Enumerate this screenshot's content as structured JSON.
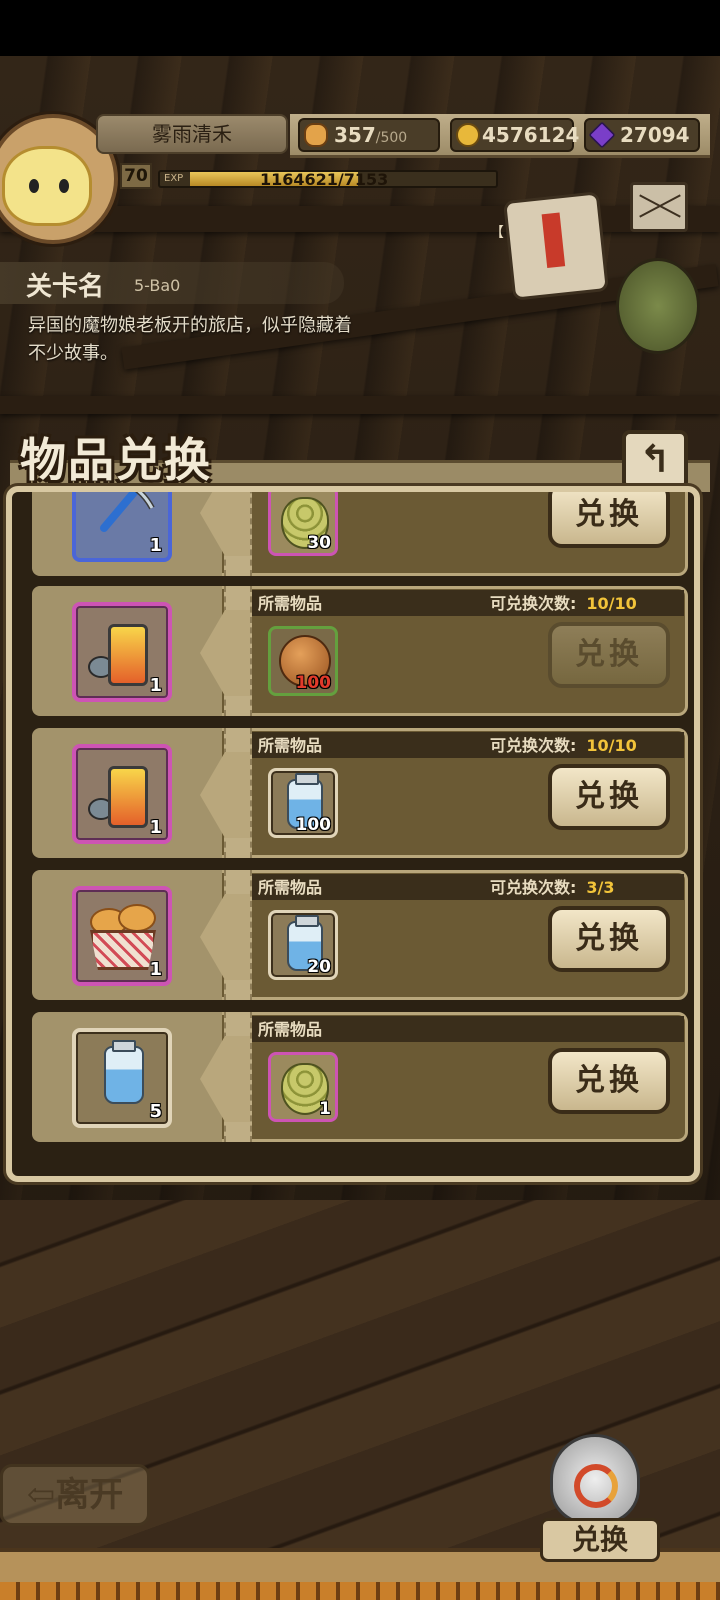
{
  "player": {
    "name": "雾雨清禾",
    "level": "70",
    "exp_tag": "EXP",
    "exp_text": "1164621/7153",
    "exp_progress": 0.55
  },
  "resources": {
    "stamina": "357",
    "stamina_cap": "/500",
    "gold": "4576124",
    "gems": "27094"
  },
  "quest_tag": "【",
  "stage": {
    "label": "关卡名",
    "code": "5-Ba0",
    "description": "异国的魔物娘老板开的旅店，似乎隐藏着不少故事。"
  },
  "panel": {
    "title": "物品兑换",
    "back_glyph": "↰",
    "required_label": "所需物品",
    "count_label": "可兑换次数:",
    "exchange_label": "兑换",
    "rows": [
      {
        "reward_icon": "pickaxe-icon",
        "reward_qty": "1",
        "cost_icon": "hop-icon",
        "cost_qty": "30",
        "count": ""
      },
      {
        "reward_icon": "engine-icon",
        "reward_qty": "1",
        "cost_icon": "coconut-icon",
        "cost_qty": "100",
        "count": "10/10",
        "disabled": true
      },
      {
        "reward_icon": "engine-icon",
        "reward_qty": "1",
        "cost_icon": "milk-jar-icon",
        "cost_qty": "100",
        "count": "10/10"
      },
      {
        "reward_icon": "bread-basket-icon",
        "reward_qty": "1",
        "cost_icon": "milk-jar-icon",
        "cost_qty": "20",
        "count": "3/3"
      },
      {
        "reward_icon": "milk-jar-icon",
        "reward_qty": "5",
        "cost_icon": "hop-icon",
        "cost_qty": "1",
        "count": ""
      }
    ]
  },
  "bottom": {
    "leave_label": "⇦离开",
    "exchange_label": "兑换"
  },
  "colors": {
    "epic_border": "#cd54b4",
    "rare_border": "#4a66d8",
    "count_value": "#f2c43a",
    "low_qty": "#e23a2a"
  }
}
